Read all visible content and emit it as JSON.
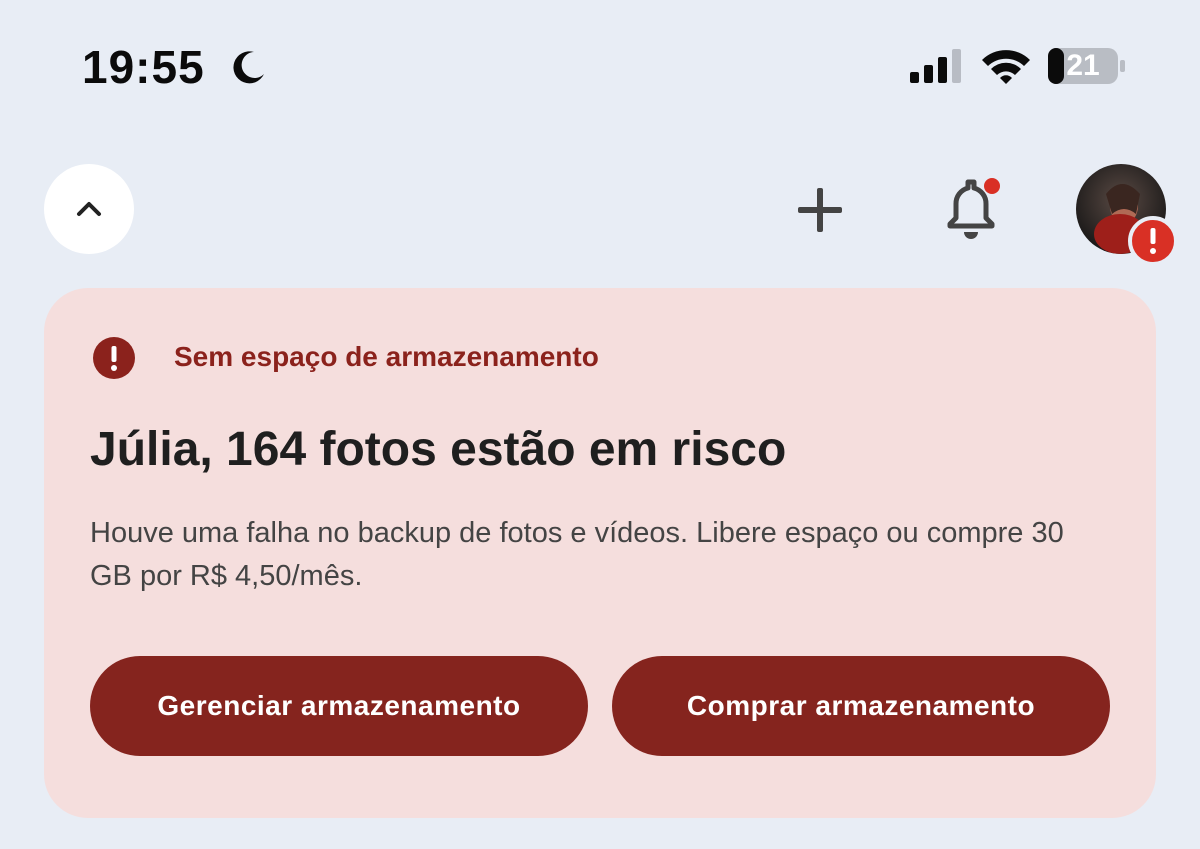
{
  "status_bar": {
    "time": "19:55",
    "battery_level": "21",
    "icons": [
      "moon-icon",
      "signal-icon",
      "wifi-icon",
      "battery-icon"
    ]
  },
  "top_bar": {
    "icons": [
      "chevron-up-icon",
      "plus-icon",
      "bell-icon",
      "avatar",
      "alert-icon"
    ]
  },
  "storage_card": {
    "label": "Sem espaço de armazenamento",
    "title": "Júlia, 164 fotos estão em risco",
    "body": "Houve uma falha no backup de fotos e vídeos. Libere espaço ou compre 30 GB por R$ 4,50/mês.",
    "manage_button": "Gerenciar armazenamento",
    "buy_button": "Comprar armazenamento"
  },
  "colors": {
    "background": "#e8edf5",
    "card_background": "#f5dedd",
    "accent_dark_red": "#85241e",
    "label_red": "#8b221c",
    "alert_red": "#d93025"
  }
}
